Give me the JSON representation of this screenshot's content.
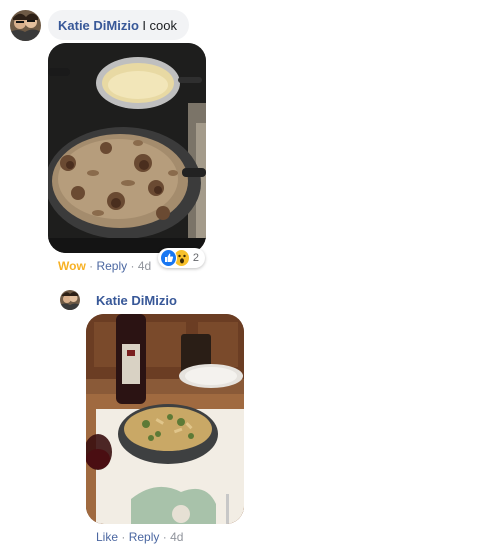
{
  "comment1": {
    "author": "Katie DiMizio",
    "text": "I cook",
    "photo_alt": "pan of meatballs and mushrooms in gravy",
    "reaction_label": "Wow",
    "reply_label": "Reply",
    "separator": "·",
    "time": "4d",
    "reaction_count": "2",
    "reaction_icons": [
      "like-icon",
      "wow-icon"
    ]
  },
  "reply1": {
    "author": "Katie DiMizio",
    "photo_alt": "bowl of pasta with wine and glass on table",
    "like_label": "Like",
    "reply_label": "Reply",
    "separator": "·",
    "time": "4d"
  },
  "colors": {
    "author_link": "#385898",
    "action_link": "#4b67a1",
    "wow": "#f7b125",
    "bubble_bg": "#f2f3f5",
    "like_blue": "#1877f2"
  }
}
